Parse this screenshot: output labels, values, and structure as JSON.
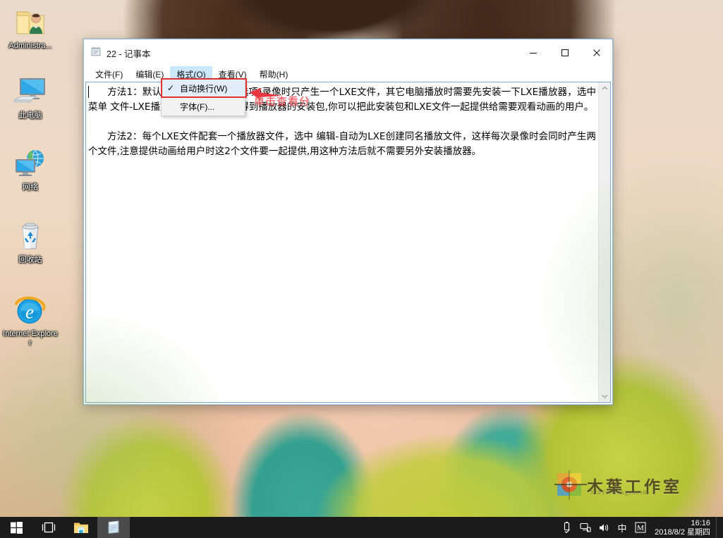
{
  "desktop": {
    "icons": [
      {
        "name": "administrator-folder",
        "label": "Administra...",
        "icon": "user-folder-icon"
      },
      {
        "name": "this-pc",
        "label": "此电脑",
        "icon": "computer-icon"
      },
      {
        "name": "network",
        "label": "网络",
        "icon": "network-icon"
      },
      {
        "name": "recycle-bin",
        "label": "回收站",
        "icon": "recycle-bin-icon"
      },
      {
        "name": "internet-explorer",
        "label": "Internet Explorer",
        "icon": "internet-explorer-icon"
      }
    ]
  },
  "notepad": {
    "title": "22 - 记事本",
    "icon": "notepad-icon",
    "window_buttons": {
      "minimize": "—",
      "maximize": "▢",
      "close": "✕"
    },
    "menus": [
      {
        "name": "file",
        "label": "文件(F)",
        "open": false
      },
      {
        "name": "edit",
        "label": "编辑(E)",
        "open": false
      },
      {
        "name": "format",
        "label": "格式(O)",
        "open": true
      },
      {
        "name": "view",
        "label": "查看(V)",
        "open": false
      },
      {
        "name": "help",
        "label": "帮助(H)",
        "open": false
      }
    ],
    "format_menu": {
      "items": [
        {
          "name": "word-wrap",
          "label": "自动换行(W)",
          "checked": true,
          "check_glyph": "✓",
          "highlighted": true
        },
        {
          "name": "font",
          "label": "字体(F)...",
          "checked": false,
          "check_glyph": "",
          "highlighted": false
        }
      ]
    },
    "content": "　　方法1：默认情况(即设置2中的选项)录像时只产生一个LXE文件，其它电脑播放时需要先安装一下LXE播放器，选中 菜单 文件-LXE播放器安装程序 可以得到播放器的安装包,你可以把此安装包和LXE文件一起提供给需要观看动画的用户。\n\n　　方法2：每个LXE文件配套一个播放器文件，选中 编辑-自动为LXE创建同名播放文件，这样每次录像时会同时产生两个文件,注意提供动画给用户时这2个文件要一起提供,用这种方法后就不需要另外安装播放器。",
    "scrollbar": {
      "up_arrow": "⌃",
      "down_arrow": "⌄"
    }
  },
  "annotation": {
    "text": "单击查看分",
    "color": "#f1545a",
    "highlight_color": "#e03030",
    "arrow": "arrow-left-icon"
  },
  "watermark": {
    "text": "木葉工作室",
    "subtext": "XinYe.Gongzuoshi",
    "logo": "pinwheel-logo-icon"
  },
  "taskbar": {
    "start": {
      "name": "start-button",
      "icon": "windows-logo-icon"
    },
    "buttons": [
      {
        "name": "task-view",
        "icon": "task-view-icon",
        "active": false
      },
      {
        "name": "file-explorer",
        "icon": "folder-icon",
        "active": false
      },
      {
        "name": "notepad-task",
        "icon": "notepad-icon",
        "active": true
      }
    ],
    "tray": [
      {
        "name": "usb-safely-remove",
        "icon": "usb-icon",
        "glyph": "⌸"
      },
      {
        "name": "network-status",
        "icon": "network-icon",
        "glyph": "🖧"
      },
      {
        "name": "volume",
        "icon": "speaker-icon",
        "glyph": "🔊"
      },
      {
        "name": "ime-chinese",
        "icon": "ime-icon",
        "glyph": "中"
      },
      {
        "name": "ime-mode",
        "icon": "ime-mode-icon",
        "glyph": "M"
      }
    ],
    "clock": {
      "time": "16:16",
      "date": "2018/8/2 星期四"
    }
  },
  "colors": {
    "accent": "#cce8ff",
    "window_border": "#9bbcd8",
    "taskbar_bg": "#1b1b1b",
    "annotation_red": "#f1545a"
  }
}
